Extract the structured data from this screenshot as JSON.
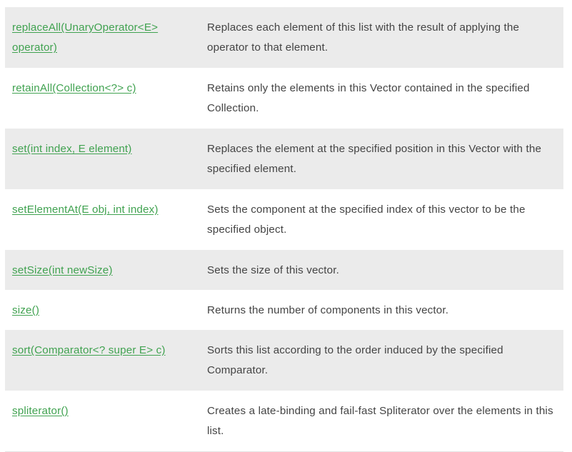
{
  "table": {
    "rows": [
      {
        "method": "replaceAll(UnaryOperator<E> operator)",
        "description": "Replaces each element of this list with the result of applying the operator to that element."
      },
      {
        "method": "retainAll(Collection<?> c)",
        "description": "Retains only the elements in this Vector contained in the specified Collection."
      },
      {
        "method": "set(int index, E element)",
        "description": "Replaces the element at the specified position in this Vector with the specified element."
      },
      {
        "method": "setElementAt(E obj, int index)",
        "description": "Sets the component at the specified index of this vector to be the specified object."
      },
      {
        "method": "setSize(int newSize)",
        "description": "Sets the size of this vector."
      },
      {
        "method": "size()",
        "description": "Returns the number of components in this vector."
      },
      {
        "method": "sort(Comparator<? super E> c)",
        "description": "Sorts this list according to the order induced by the specified Comparator."
      },
      {
        "method": "spliterator()",
        "description": "Creates a late-binding and fail-fast Spliterator over the elements in this list."
      }
    ]
  },
  "colors": {
    "link": "#40a250",
    "text": "#444444",
    "row_shaded": "#ebebeb",
    "row_plain": "#ffffff"
  }
}
